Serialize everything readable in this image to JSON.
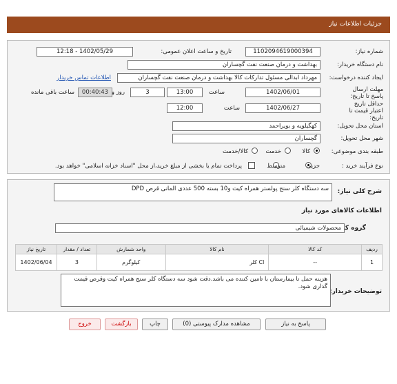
{
  "header": {
    "title": "جزئیات اطلاعات نیاز"
  },
  "form": {
    "need_number_label": "شماره نیاز:",
    "need_number": "1102094619000394",
    "announce_label": "تاریخ و ساعت اعلان عمومی:",
    "announce_value": "1402/05/29 - 12:18",
    "buyer_org_label": "نام دستگاه خریدار:",
    "buyer_org": "بهداشت و درمان صنعت نفت گچساران",
    "creator_label": "ایجاد کننده درخواست:",
    "creator": "مهرداد ابدالی مسئول تدارکات کالا  بهداشت و درمان صنعت نفت گچساران",
    "contact_link": "اطلاعات تماس خریدار",
    "deadline_label": "مهلت ارسال پاسخ تا تاریخ:",
    "deadline_date": "1402/06/01",
    "time_label": "ساعت",
    "deadline_time": "13:00",
    "day_value": "3",
    "day_label": "روز و",
    "remaining_time": "00:40:43",
    "remaining_label": "ساعت باقی مانده",
    "validity_label": "حداقل تاریخ اعتبار قیمت تا تاریخ:",
    "validity_date": "1402/06/27",
    "validity_time": "12:00",
    "province_label": "استان محل تحویل:",
    "province": "کهگیلویه و بویراحمد",
    "city_label": "شهر محل تحویل:",
    "city": "گچساران",
    "category_label": "طبقه بندی موضوعی:",
    "category_options": [
      "کالا",
      "خدمت",
      "کالا/خدمت"
    ],
    "category_selected": 0,
    "process_label": "نوع فرآیند خرید :",
    "process_options": [
      "جزیی",
      "متوسط"
    ],
    "process_selected": 0,
    "payment_note": "پرداخت تمام یا بخشی از مبلغ خرید،از محل \"اسناد خزانه اسلامی\" خواهد بود."
  },
  "need": {
    "summary_label": "شرح کلی نیاز:",
    "summary": "سه دستگاه کلر سنج پولستر همراه کیت و10 بسته 500 عددی المانی قرص DPD",
    "goods_info_title": "اطلاعات کالاهای مورد نیاز",
    "group_label": "گروه کالا:",
    "group_value": "محصولات شیمیائی",
    "table": {
      "headers": [
        "ردیف",
        "کد کالا",
        "نام کالا",
        "واحد شمارش",
        "تعداد / مقدار",
        "تاریخ نیاز"
      ],
      "rows": [
        [
          "1",
          "--",
          "کلر Cl",
          "کیلوگرم",
          "3",
          "1402/06/04"
        ]
      ]
    },
    "buyer_notes_label": "توضیحات خریدار:",
    "buyer_notes": "هزینه حمل تا بیمارستان با تامین کننده می باشد.دقت شود سه دستگاه کلر سنج همراه کیت وقرص قیمت گذاری شود."
  },
  "buttons": {
    "reply": "پاسخ به نیاز",
    "attachments": "مشاهده مدارک پیوستی (0)",
    "print": "چاپ",
    "back": "بازگشت",
    "exit": "خروج"
  }
}
